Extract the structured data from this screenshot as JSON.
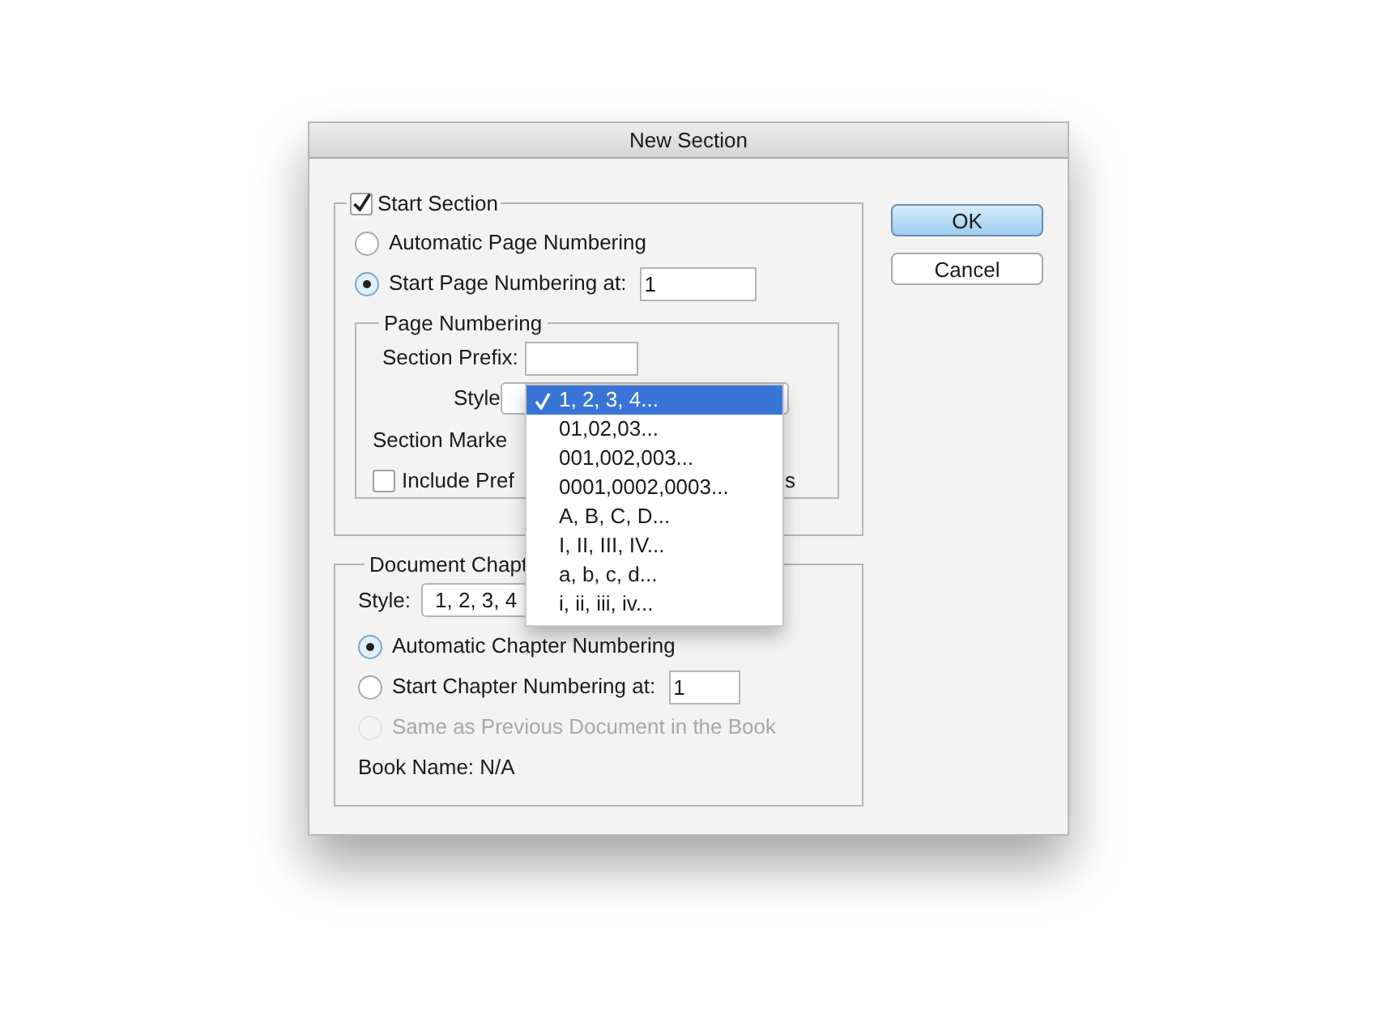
{
  "window": {
    "title": "New Section"
  },
  "buttons": [
    {
      "label": "OK",
      "default": true
    },
    {
      "label": "Cancel",
      "default": false
    }
  ],
  "start_section": {
    "label": "Start Section",
    "checked": true,
    "options": [
      {
        "label": "Automatic Page Numbering",
        "selected": false
      },
      {
        "label": "Start Page Numbering at:",
        "selected": true,
        "value": "1"
      }
    ],
    "page_numbering": {
      "title": "Page Numbering",
      "section_prefix": {
        "label": "Section Prefix:"
      },
      "style": {
        "label": "Style"
      },
      "section_marker": {
        "label": "Section Marke"
      },
      "include_prefix": {
        "label": "Include Pref",
        "checked": false,
        "label_tail": "s"
      }
    }
  },
  "document_chapter": {
    "title": "Document Chapt",
    "style": {
      "label": "Style:",
      "value": "1, 2, 3, 4"
    },
    "options": [
      {
        "label": "Automatic Chapter Numbering",
        "selected": true,
        "disabled": false
      },
      {
        "label": "Start Chapter Numbering at:",
        "selected": false,
        "disabled": false,
        "value": "1"
      },
      {
        "label": "Same as Previous Document in the Book",
        "selected": false,
        "disabled": true
      }
    ],
    "book_name": "Book Name: N/A"
  },
  "style_menu": {
    "items": [
      {
        "label": "1, 2, 3, 4...",
        "selected": true
      },
      {
        "label": "01,02,03...",
        "selected": false
      },
      {
        "label": "001,002,003...",
        "selected": false
      },
      {
        "label": "0001,0002,0003...",
        "selected": false
      },
      {
        "label": "A, B, C, D...",
        "selected": false
      },
      {
        "label": "I, II, III, IV...",
        "selected": false
      },
      {
        "label": "a, b, c, d...",
        "selected": false
      },
      {
        "label": "i, ii, iii, iv...",
        "selected": false
      }
    ]
  }
}
